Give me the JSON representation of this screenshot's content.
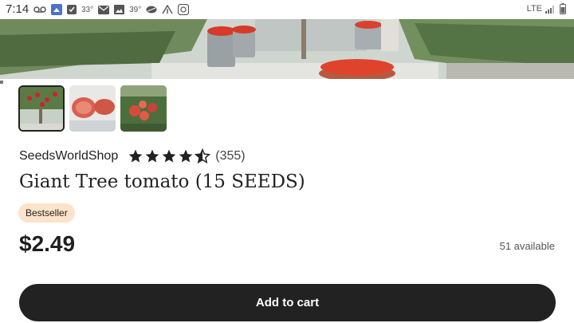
{
  "status_bar": {
    "time": "7:14",
    "temp1": "33°",
    "temp2": "39°",
    "network": "LTE"
  },
  "product": {
    "shop_name": "SeedsWorldShop",
    "rating": 4.5,
    "rating_max": 5,
    "review_count": "(355)",
    "title": "Giant Tree tomato (15 SEEDS)",
    "badge": "Bestseller",
    "price": "$2.49",
    "availability": "51 available",
    "thumbnail_count": 3,
    "selected_thumbnail": 1
  },
  "actions": {
    "add_to_cart": "Add to cart"
  },
  "colors": {
    "button_bg": "#222222",
    "badge_bg": "#fde3c9",
    "star": "#222222"
  }
}
